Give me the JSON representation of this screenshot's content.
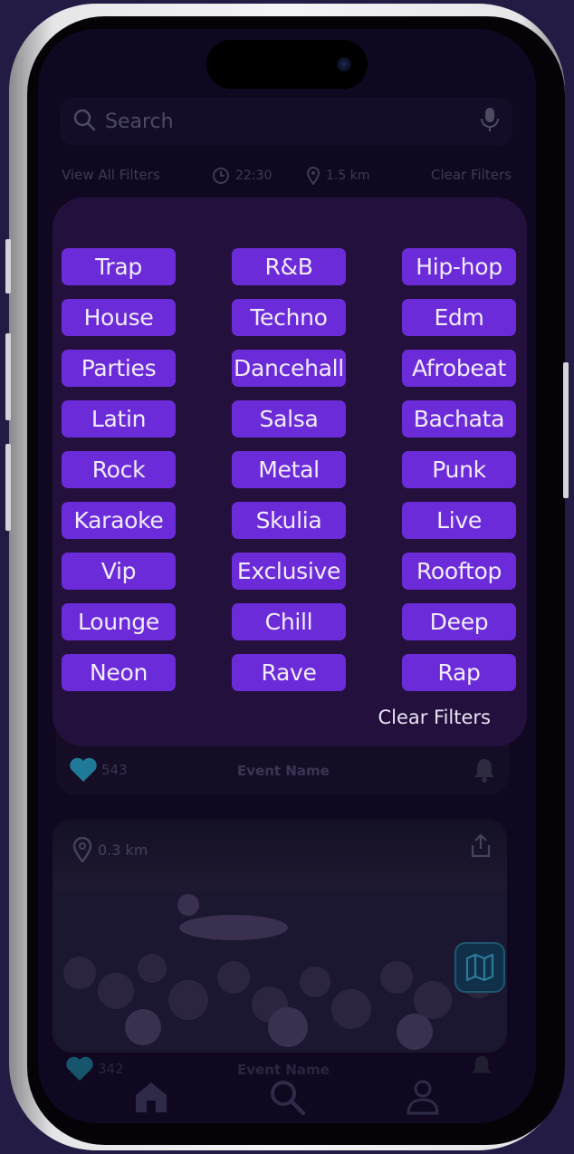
{
  "search": {
    "placeholder": "Search"
  },
  "filter_bar": {
    "view_all_label": "View All Filters",
    "time": "22:30",
    "distance": "1.5 km",
    "clear_label": "Clear Filters"
  },
  "genres": [
    "Trap",
    "R&B",
    "Hip-hop",
    "House",
    "Techno",
    "Edm",
    "Parties",
    "Dancehall",
    "Afrobeat",
    "Latin",
    "Salsa",
    "Bachata",
    "Rock",
    "Metal",
    "Punk",
    "Karaoke",
    "Skulia",
    "Live",
    "Vip",
    "Exclusive",
    "Rooftop",
    "Lounge",
    "Chill",
    "Deep",
    "Neon",
    "Rave",
    "Rap"
  ],
  "modal": {
    "clear_label": "Clear Filters"
  },
  "event_card_1": {
    "likes": "543",
    "title": "Event Name"
  },
  "event_card_2": {
    "distance": "0.3 km"
  },
  "event_card_3": {
    "likes": "342",
    "title": "Event Name"
  },
  "colors": {
    "chip": "#6c2bd9",
    "modal": "#24103d",
    "screen": "#0f0820",
    "heart": "#2ab7d6"
  },
  "icons": {
    "search": "magnifier-icon",
    "mic": "microphone-icon",
    "clock": "clock-icon",
    "pin": "location-pin-icon",
    "heart": "heart-icon",
    "bell": "bell-icon",
    "share": "share-icon",
    "map": "map-icon",
    "home": "home-icon",
    "user": "user-icon"
  }
}
